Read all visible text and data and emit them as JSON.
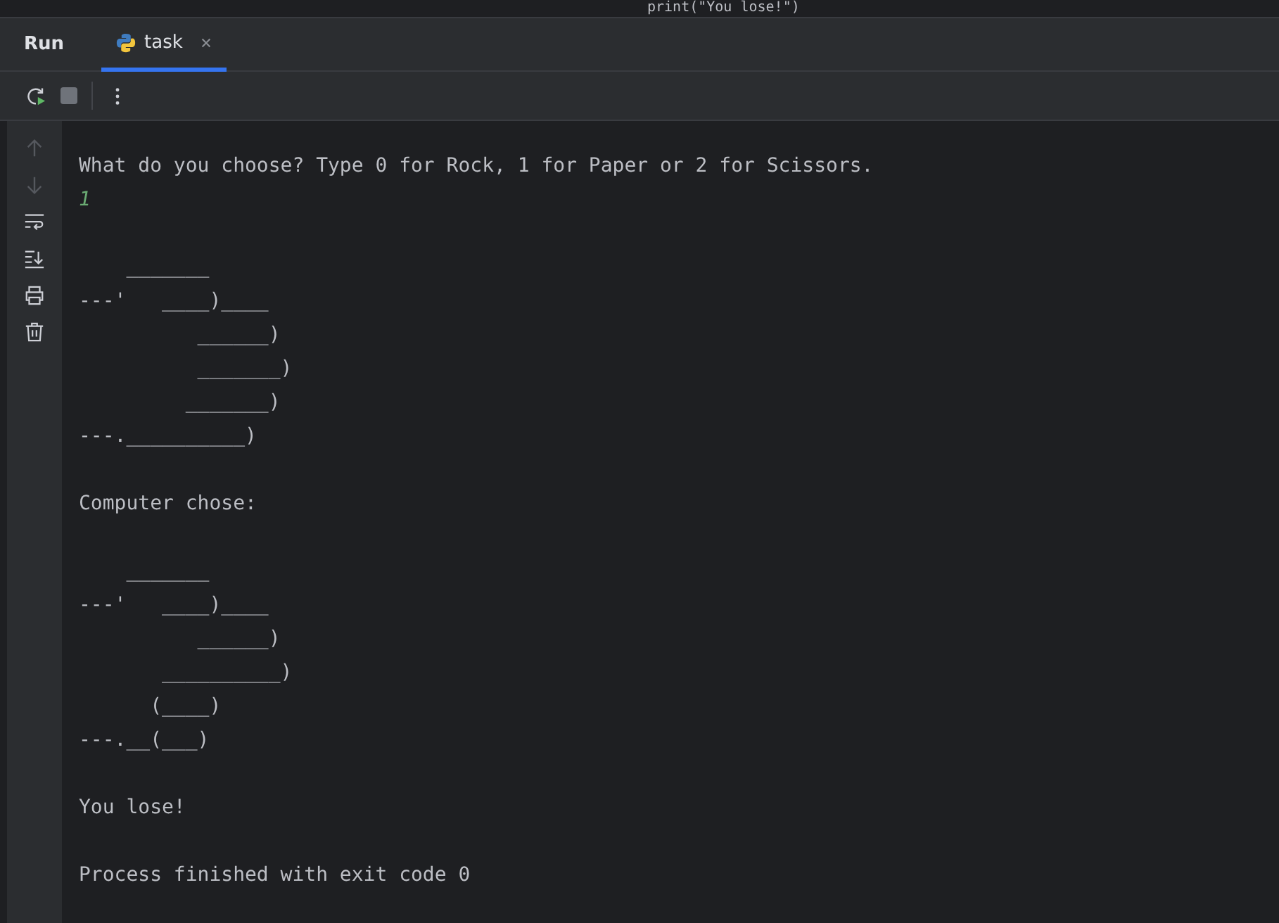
{
  "editor_peek": {
    "code": "print(\"You lose!\")"
  },
  "tool_window": {
    "title": "Run",
    "tabs": [
      {
        "label": "task",
        "selected": true
      }
    ]
  },
  "console": {
    "blocks": [
      {
        "lines": [
          {
            "kind": "output",
            "text": "What do you choose? Type 0 for Rock, 1 for Paper or 2 for Scissors."
          },
          {
            "kind": "input",
            "text": "1"
          }
        ]
      },
      {
        "lines": [
          {
            "kind": "output",
            "text": "    _______"
          },
          {
            "kind": "output",
            "text": "---'   ____)____"
          },
          {
            "kind": "output",
            "text": "          ______)"
          },
          {
            "kind": "output",
            "text": "          _______)"
          },
          {
            "kind": "output",
            "text": "         _______)"
          },
          {
            "kind": "output",
            "text": "---.__________)"
          }
        ]
      },
      {
        "lines": [
          {
            "kind": "output",
            "text": "Computer chose:"
          }
        ]
      },
      {
        "lines": [
          {
            "kind": "output",
            "text": "    _______"
          },
          {
            "kind": "output",
            "text": "---'   ____)____"
          },
          {
            "kind": "output",
            "text": "          ______)"
          },
          {
            "kind": "output",
            "text": "       __________)"
          },
          {
            "kind": "output",
            "text": "      (____)"
          },
          {
            "kind": "output",
            "text": "---.__(___)"
          }
        ]
      },
      {
        "lines": [
          {
            "kind": "output",
            "text": "You lose!"
          }
        ]
      },
      {
        "lines": [
          {
            "kind": "output",
            "text": "Process finished with exit code 0"
          }
        ]
      }
    ]
  }
}
